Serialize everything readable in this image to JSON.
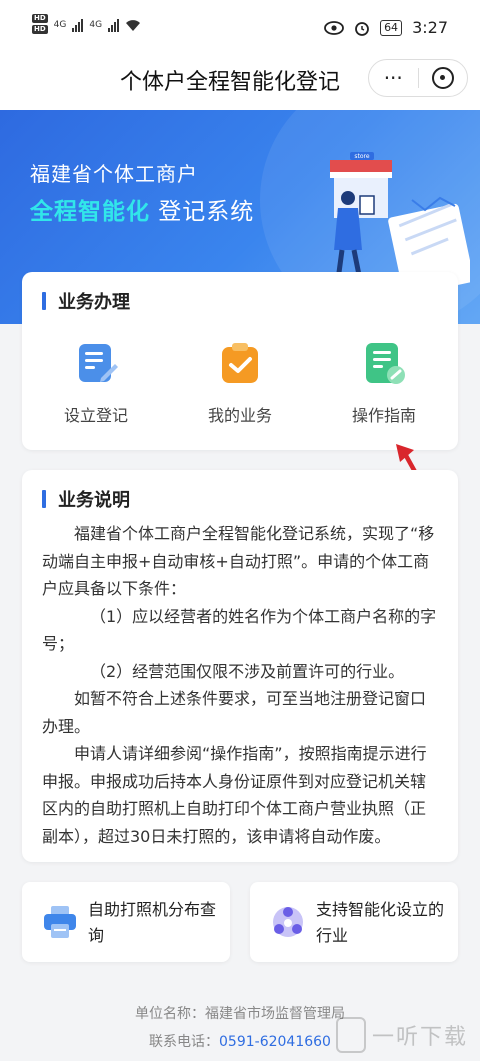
{
  "status_bar": {
    "network": "4G",
    "battery": "64",
    "time": "3:27"
  },
  "nav": {
    "title": "个体户全程智能化登记",
    "more_label": "···"
  },
  "banner": {
    "line1": "福建省个体工商户",
    "highlight": "全程智能化",
    "line2_rest": " 登记系统",
    "store_sign": "store"
  },
  "business": {
    "title": "业务办理",
    "items": [
      {
        "label": "设立登记",
        "icon": "document-edit-icon"
      },
      {
        "label": "我的业务",
        "icon": "clipboard-check-icon"
      },
      {
        "label": "操作指南",
        "icon": "guide-book-icon"
      }
    ]
  },
  "description": {
    "title": "业务说明",
    "paragraphs": [
      "福建省个体工商户全程智能化登记系统，实现了“移动端自主申报+自动审核+自动打照”。申请的个体工商户应具备以下条件：",
      "（1）应以经营者的姓名作为个体工商户名称的字号；",
      "（2）经营范围仅限不涉及前置许可的行业。",
      "如暂不符合上述条件要求，可至当地注册登记窗口办理。",
      "申请人请详细参阅“操作指南”，按照指南提示进行申报。申报成功后持本人身份证原件到对应登记机关辖区内的自助打照机上自助打印个体工商户营业执照（正副本），超过30日未打照的，该申请将自动作废。"
    ]
  },
  "tiles": [
    {
      "label": "自助打照机分布查询",
      "icon": "printer-icon"
    },
    {
      "label": "支持智能化设立的行业",
      "icon": "industry-icon"
    }
  ],
  "footer": {
    "unit_label": "单位名称：",
    "unit_name": "福建省市场监督管理局",
    "phone_label": "联系电话：",
    "phone": "0591-62041660"
  },
  "watermark": {
    "text": "一听下载"
  },
  "colors": {
    "primary": "#2f6de1",
    "highlight": "#31e6ea",
    "arrow": "#d9262c"
  }
}
